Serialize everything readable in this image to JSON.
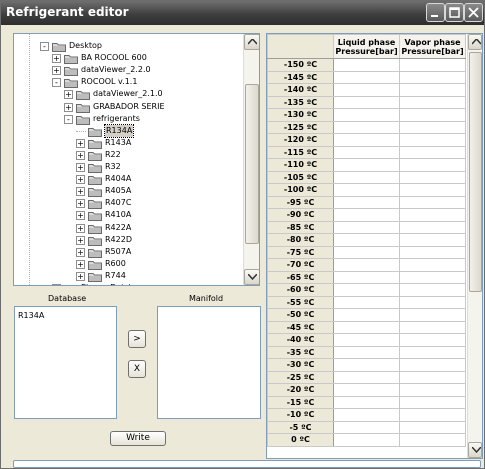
{
  "window": {
    "title": "Refrigerant editor"
  },
  "tree": {
    "items": [
      {
        "label": "Desktop",
        "indent": 0,
        "expander": "-"
      },
      {
        "label": "BA ROCOOL 600",
        "indent": 1,
        "expander": "+"
      },
      {
        "label": "dataViewer_2.2.0",
        "indent": 1,
        "expander": "+"
      },
      {
        "label": "ROCOOL v.1.1",
        "indent": 1,
        "expander": "-"
      },
      {
        "label": "dataViewer_2.1.0",
        "indent": 2,
        "expander": "+"
      },
      {
        "label": "GRABADOR SERIE",
        "indent": 2,
        "expander": "+"
      },
      {
        "label": "refrigerants",
        "indent": 2,
        "expander": "-"
      },
      {
        "label": "R134A",
        "indent": 3,
        "expander": "",
        "selected": true
      },
      {
        "label": "R143A",
        "indent": 3,
        "expander": "+"
      },
      {
        "label": "R22",
        "indent": 3,
        "expander": "+"
      },
      {
        "label": "R32",
        "indent": 3,
        "expander": "+"
      },
      {
        "label": "R404A",
        "indent": 3,
        "expander": "+"
      },
      {
        "label": "R405A",
        "indent": 3,
        "expander": "+"
      },
      {
        "label": "R407C",
        "indent": 3,
        "expander": "+"
      },
      {
        "label": "R410A",
        "indent": 3,
        "expander": "+"
      },
      {
        "label": "R422A",
        "indent": 3,
        "expander": "+"
      },
      {
        "label": "R422D",
        "indent": 3,
        "expander": "+"
      },
      {
        "label": "R507A",
        "indent": 3,
        "expander": "+"
      },
      {
        "label": "R600",
        "indent": 3,
        "expander": "+"
      },
      {
        "label": "R744",
        "indent": 3,
        "expander": "+"
      },
      {
        "label": "Eicone Datsios",
        "indent": 1,
        "expander": "+"
      }
    ]
  },
  "database": {
    "label": "Database",
    "items": [
      "R134A"
    ]
  },
  "manifold": {
    "label": "Manifold",
    "items": []
  },
  "buttons": {
    "add": ">",
    "remove": "X",
    "write": "Write"
  },
  "table": {
    "headers": [
      "",
      "Liquid phase Pressure[bar]",
      "Vapor phase Pressure[bar]"
    ],
    "header_lines": [
      [
        "Liquid phase",
        "Pressure[bar]"
      ],
      [
        "Vapor phase",
        "Pressure[bar]"
      ]
    ],
    "rows": [
      "-150 ºC",
      "-145 ºC",
      "-140 ºC",
      "-135 ºC",
      "-130 ºC",
      "-125 ºC",
      "-120 ºC",
      "-115 ºC",
      "-110 ºC",
      "-105 ºC",
      "-100 ºC",
      "-95 ºC",
      "-90 ºC",
      "-85 ºC",
      "-80 ºC",
      "-75 ºC",
      "-70 ºC",
      "-65 ºC",
      "-60 ºC",
      "-55 ºC",
      "-50 ºC",
      "-45 ºC",
      "-40 ºC",
      "-35 ºC",
      "-30 ºC",
      "-25 ºC",
      "-20 ºC",
      "-15 ºC",
      "-10 ºC",
      "-5 ºC",
      "0 ºC"
    ]
  },
  "colors": {
    "titlebar": "#3f3f3f",
    "border": "#7f9db9",
    "panel": "#ece9d8",
    "selection": "#d4d0c8"
  }
}
